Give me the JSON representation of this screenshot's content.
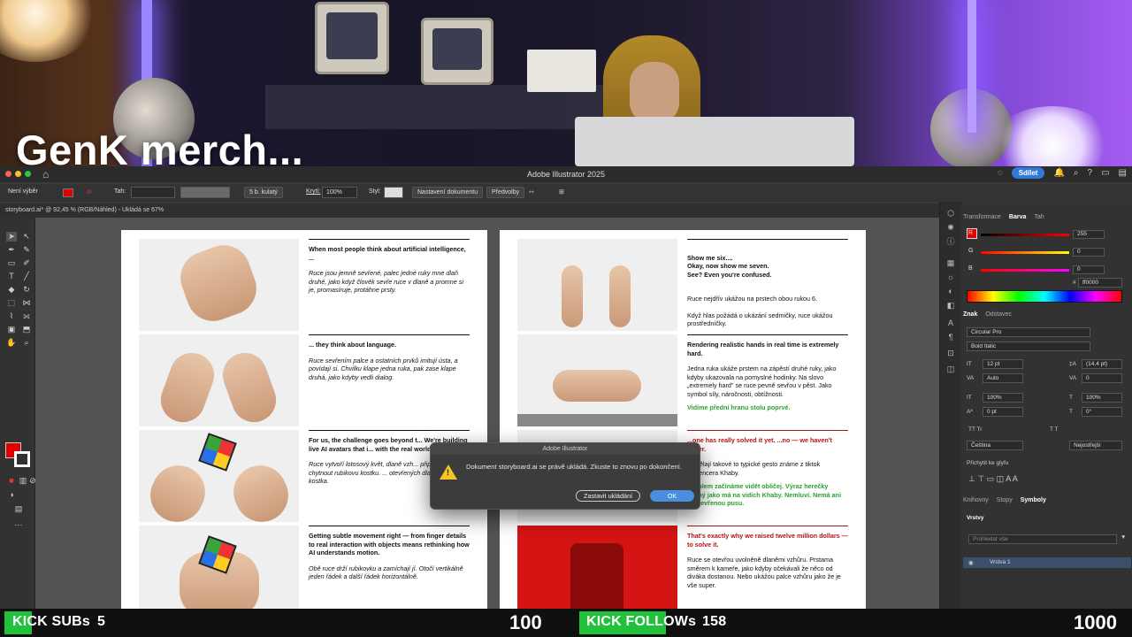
{
  "overlay": {
    "title": "GenK merch..."
  },
  "app": {
    "title": "Adobe Illustrator 2025",
    "share_label": "Sdílet",
    "doc_tab": "storyboard.ai* @ 92,45 % (RGB/Náhled) - Ukládá se 67%",
    "control_bar": {
      "selection": "Není výběr",
      "stroke_label": "Tah:",
      "brush": "5 b. kulatý",
      "opacity_label": "Krytí:",
      "opacity_value": "100%",
      "style_label": "Styl:",
      "doc_setup": "Nastavení dokumentu",
      "preferences": "Předvolby"
    }
  },
  "artboard_left": [
    {
      "heading": "When most people think about artificial intelligence, ...",
      "body": "Ruce jsou jemně sevřené, palec jedné ruky mne dlaň druhé, jako když člověk sevře ruce v dlaně a promne si je, promasíruje, protáhne prsty."
    },
    {
      "heading": "... they think about language.",
      "body": "Ruce sevřením palce a ostatních prvků imitují ústa, a povídají si. Chvilku klape jedna ruka, pak zase klape druhá, jako kdyby vedli dialog."
    },
    {
      "heading": "For us, the challenge goes beyond t... We're building live AI avatars that i... with the real world.",
      "body": "Ruce vytvoří lotosový květ, dlaně vzh... připraveny chytnout rubikovu kostku. ... otevřených dlaní spadne kostka."
    },
    {
      "heading": "Getting subtle movement right — from finger details to real interaction with objects means rethinking how AI understands motion.",
      "body": "Obě ruce drží rubikovku a zamíchají jí. Otočí vertikálně jeden řádek a další řádek horizontálně."
    }
  ],
  "artboard_right": [
    {
      "heading": "Show me six....\nOkay, now show me seven.\nSee? Even you're confused.",
      "body": "Ruce nejdřív ukážou na prstech obou rukou 6.\n\nKdyž hlas požádá o ukázání sedmičky, ruce ukážou prostředníčky."
    },
    {
      "heading": "Rendering realistic hands in real time is extremely hard.",
      "body": "Jedna ruka ukáže prstem na zápěstí druhé ruky, jako kdyby ukazovala na pomyslné hodinky. Na slovo „extremely hard\" se ruce pevně sevřou v pěst. Jako symbol síly, náročnosti, obtížnosti.",
      "green": "Vidíme přední hranu stolu poprvé."
    },
    {
      "heading": "...one has really solved it yet. ...no — we haven't either.",
      "body": "...udělají takové to typické gesto známe z tiktok influencera Khaby.",
      "green": "...stolem začínáme vidět obličej. Výraz herečky stejný jako má na vidích Khaby. Nemluví. Nemá ani postevřenou pusu."
    },
    {
      "heading": "That's exactly why we raised twelve million dollars — to solve it.",
      "body": "Ruce se otevřou uvolněně dlaněmi vzhůru. Prstama směrem k kameře, jako kdyby očekávali že něco od diváka dostanou. Nebo ukážou palce vzhůru jako že je vše super."
    }
  ],
  "dialog": {
    "title": "Adobe Illustrator",
    "message": "Dokument storyboard.ai se právě ukládá. Zkuste to znovu po dokončení.",
    "stop_label": "Zastavit ukládání",
    "ok_label": "OK"
  },
  "panels": {
    "tabs_top": [
      "Transformace",
      "Barva",
      "Tah"
    ],
    "rgb": [
      {
        "label": "R",
        "value": "255"
      },
      {
        "label": "G",
        "value": "0"
      },
      {
        "label": "B",
        "value": "0"
      }
    ],
    "hex": "ff0000",
    "tabs_char": [
      "Znak",
      "Odstavec"
    ],
    "font_family": "Circular Pro",
    "font_style": "Bold Italic",
    "font_size": "12 pt",
    "leading": "(14,4 pt)",
    "kerning": "Auto",
    "tracking": "0",
    "vscale": "100%",
    "hscale": "100%",
    "baseline": "0 pt",
    "rotation": "0°",
    "language": "Čeština",
    "aa": "Nejostřejší",
    "snap_label": "Přichytit ke glyfu",
    "tabs_lib": [
      "Knihovny",
      "Stopy",
      "Symboly"
    ],
    "layers_title": "Vrstvy",
    "layers_search": "Prohledat vše",
    "layer_name": "Vrstva 1"
  },
  "stream": {
    "subs_label": "KICK SUBs",
    "subs_count": "5",
    "subs_goal": "100",
    "subs_progress": 0.05,
    "follows_label": "KICK FOLLOWs",
    "follows_count": "158",
    "follows_goal": "1000",
    "follows_progress": 0.158,
    "accent_color": "#21c13c"
  }
}
